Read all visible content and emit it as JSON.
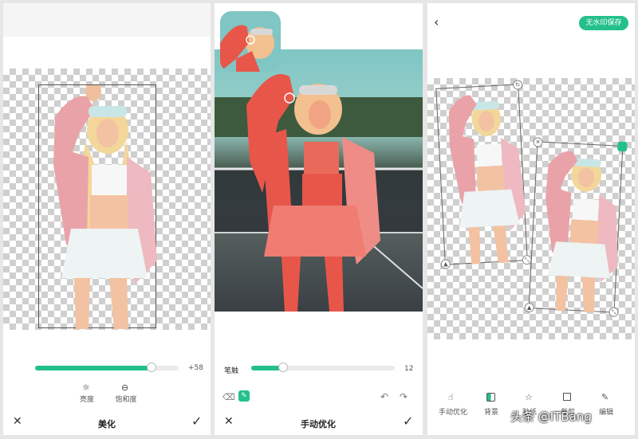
{
  "panel1": {
    "slider_value": "+58",
    "slider_level": 0.81,
    "tools": [
      {
        "label": "亮度",
        "icon": "sun-icon"
      },
      {
        "label": "饱和度",
        "icon": "saturation-icon"
      }
    ],
    "title": "美化"
  },
  "panel2": {
    "brush_label": "笔触",
    "brush_value": "12",
    "brush_level": 0.22,
    "title": "手动优化"
  },
  "panel3": {
    "save_button": "无水印保存",
    "tools": [
      {
        "label": "手动优化",
        "icon": "hand-icon"
      },
      {
        "label": "背景",
        "icon": "background-icon"
      },
      {
        "label": "贴纸",
        "icon": "star-icon"
      },
      {
        "label": "裁剪",
        "icon": "crop-icon"
      },
      {
        "label": "编辑",
        "icon": "edit-icon"
      }
    ]
  },
  "watermark": "头条 @ITBang",
  "colors": {
    "accent": "#23c08a",
    "pink": "#e9a3a8",
    "red_overlay": "#e8564a"
  }
}
